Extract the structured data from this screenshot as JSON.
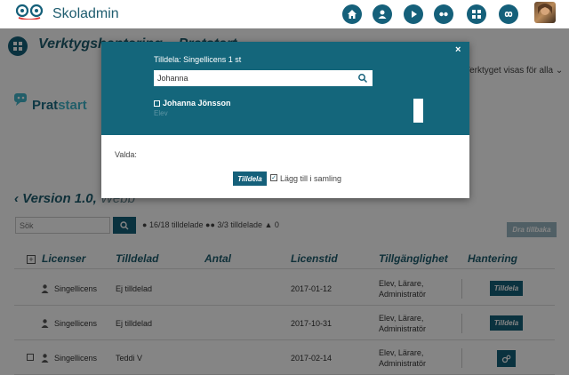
{
  "app": {
    "title": "Skoladmin"
  },
  "nav": {
    "icons": [
      "home-icon",
      "user-icon",
      "play-icon",
      "dots-icon",
      "grid-icon",
      "infinity-icon"
    ]
  },
  "page": {
    "tool_title": "Verktygshantering – Pratstart",
    "visibility_text": "Verktyget visas för alla",
    "logo_text_a": "Prat",
    "logo_text_b": "start",
    "version_label": "Version 1.0,",
    "version_platform": "Webb",
    "search_placeholder": "Sök",
    "stats_assigned": "16/18 tilldelade",
    "stats_groups": "3/3 tilldelade",
    "stats_schools": "0",
    "return_button": "Dra tillbaka"
  },
  "table": {
    "headers": [
      "Licenser",
      "Tilldelad",
      "Antal",
      "Licenstid",
      "Tillgänglighet",
      "Hantering"
    ],
    "rows": [
      {
        "license": "Singellicens",
        "assigned": "Ej tilldelad",
        "time": "2017-01-12",
        "access_1": "Elev, Lärare,",
        "access_2": "Administratör",
        "action": "Tilldela"
      },
      {
        "license": "Singellicens",
        "assigned": "Ej tilldelad",
        "time": "2017-10-31",
        "access_1": "Elev, Lärare,",
        "access_2": "Administratör",
        "action": "Tilldela"
      },
      {
        "license": "Singellicens",
        "assigned": "Teddi V",
        "time": "2017-02-14",
        "access_1": "Elev, Lärare,",
        "access_2": "Administratör",
        "action": ""
      }
    ]
  },
  "modal": {
    "close": "×",
    "title": "Tilldela: Singellicens 1 st",
    "search_value": "Johanna",
    "result_name": "Johanna Jönsson",
    "result_sub": "Elev",
    "selected_label": "Valda:",
    "assign_button": "Tilldela",
    "collection_label": "Lägg till i samling"
  },
  "colors": {
    "primary": "#15607a",
    "modal_header": "#14667b"
  }
}
